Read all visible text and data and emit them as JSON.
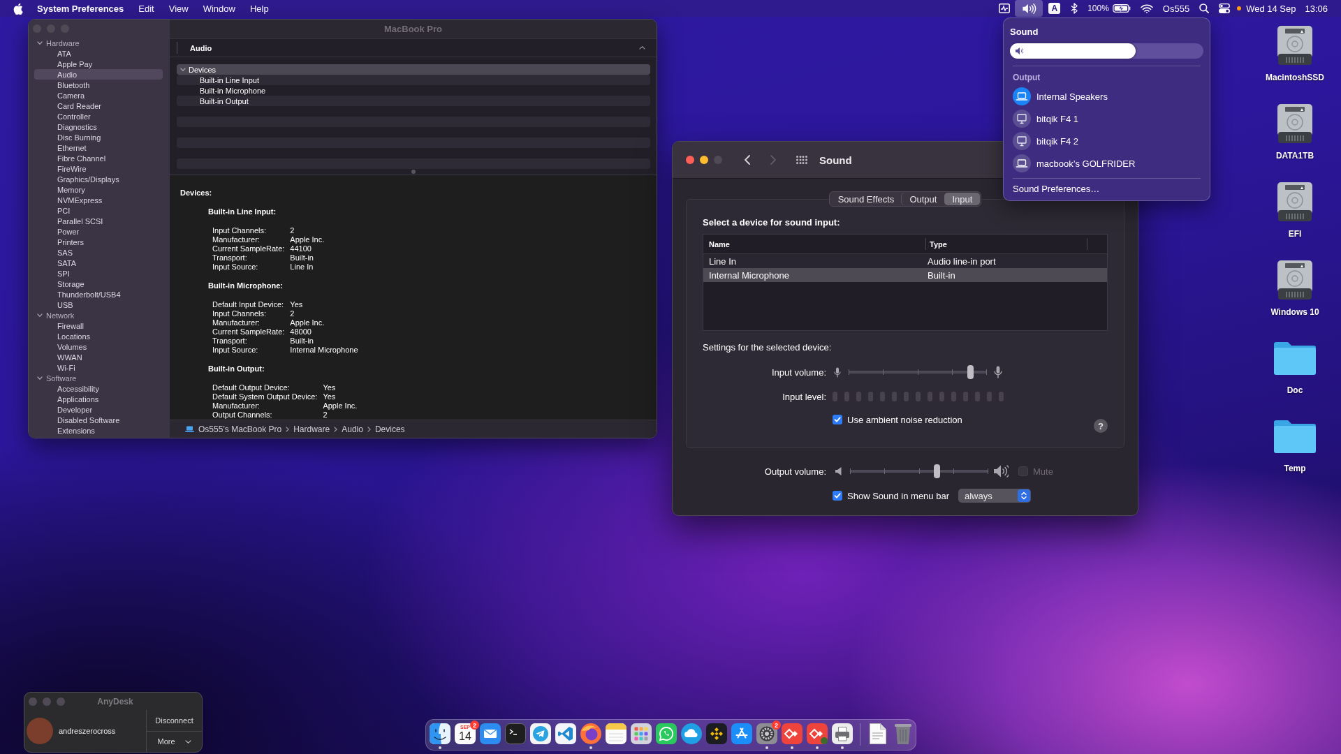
{
  "menu_bar": {
    "app_name": "System Preferences",
    "menus": [
      "Edit",
      "View",
      "Window",
      "Help"
    ],
    "status_items": [
      {
        "kind": "activity",
        "selected": false
      },
      {
        "kind": "volume",
        "selected": true
      },
      {
        "kind": "input_source",
        "label": "A",
        "selected": false
      },
      {
        "kind": "bluetooth",
        "selected": false
      },
      {
        "kind": "battery",
        "label": "100%",
        "selected": false
      },
      {
        "kind": "wifi",
        "selected": false
      },
      {
        "kind": "user",
        "label": "Os555",
        "selected": false
      },
      {
        "kind": "search",
        "selected": false
      },
      {
        "kind": "control_center",
        "selected": false
      },
      {
        "kind": "privacy_dot",
        "selected": false
      }
    ],
    "clock": {
      "date": "Wed 14 Sep",
      "time": "13:06"
    }
  },
  "system_information": {
    "title": "MacBook Pro",
    "focused": false,
    "sidebar": [
      {
        "label": "Hardware",
        "expanded": true,
        "children": [
          {
            "label": "ATA",
            "selected": false
          },
          {
            "label": "Apple Pay",
            "selected": false
          },
          {
            "label": "Audio",
            "selected": true
          },
          {
            "label": "Bluetooth",
            "selected": false
          },
          {
            "label": "Camera",
            "selected": false
          },
          {
            "label": "Card Reader",
            "selected": false
          },
          {
            "label": "Controller",
            "selected": false
          },
          {
            "label": "Diagnostics",
            "selected": false
          },
          {
            "label": "Disc Burning",
            "selected": false
          },
          {
            "label": "Ethernet",
            "selected": false
          },
          {
            "label": "Fibre Channel",
            "selected": false
          },
          {
            "label": "FireWire",
            "selected": false
          },
          {
            "label": "Graphics/Displays",
            "selected": false
          },
          {
            "label": "Memory",
            "selected": false
          },
          {
            "label": "NVMExpress",
            "selected": false
          },
          {
            "label": "PCI",
            "selected": false
          },
          {
            "label": "Parallel SCSI",
            "selected": false
          },
          {
            "label": "Power",
            "selected": false
          },
          {
            "label": "Printers",
            "selected": false
          },
          {
            "label": "SAS",
            "selected": false
          },
          {
            "label": "SATA",
            "selected": false
          },
          {
            "label": "SPI",
            "selected": false
          },
          {
            "label": "Storage",
            "selected": false
          },
          {
            "label": "Thunderbolt/USB4",
            "selected": false
          },
          {
            "label": "USB",
            "selected": false
          }
        ]
      },
      {
        "label": "Network",
        "expanded": true,
        "children": [
          {
            "label": "Firewall",
            "selected": false
          },
          {
            "label": "Locations",
            "selected": false
          },
          {
            "label": "Volumes",
            "selected": false
          },
          {
            "label": "WWAN",
            "selected": false
          },
          {
            "label": "Wi-Fi",
            "selected": false
          }
        ]
      },
      {
        "label": "Software",
        "expanded": true,
        "children": [
          {
            "label": "Accessibility",
            "selected": false
          },
          {
            "label": "Applications",
            "selected": false
          },
          {
            "label": "Developer",
            "selected": false
          },
          {
            "label": "Disabled Software",
            "selected": false
          },
          {
            "label": "Extensions",
            "selected": false
          }
        ]
      }
    ],
    "section": {
      "title": "Audio",
      "expanded": true
    },
    "tree": [
      {
        "label": "Devices",
        "expanded": true,
        "selected": true,
        "children": [
          {
            "label": "Built-in Line Input",
            "selected": false
          },
          {
            "label": "Built-in Microphone",
            "selected": false
          },
          {
            "label": "Built-in Output",
            "selected": false
          }
        ]
      }
    ],
    "details": {
      "heading": "Devices:",
      "devices": [
        {
          "name": "Built-in Line Input:",
          "properties": [
            {
              "key": "Input Channels:",
              "value": "2"
            },
            {
              "key": "Manufacturer:",
              "value": "Apple Inc."
            },
            {
              "key": "Current SampleRate:",
              "value": "44100"
            },
            {
              "key": "Transport:",
              "value": "Built-in"
            },
            {
              "key": "Input Source:",
              "value": "Line In"
            }
          ]
        },
        {
          "name": "Built-in Microphone:",
          "properties": [
            {
              "key": "Default Input Device:",
              "value": "Yes"
            },
            {
              "key": "Input Channels:",
              "value": "2"
            },
            {
              "key": "Manufacturer:",
              "value": "Apple Inc."
            },
            {
              "key": "Current SampleRate:",
              "value": "48000"
            },
            {
              "key": "Transport:",
              "value": "Built-in"
            },
            {
              "key": "Input Source:",
              "value": "Internal Microphone"
            }
          ]
        },
        {
          "name": "Built-in Output:",
          "properties": [
            {
              "key": "Default Output Device:",
              "value": "Yes"
            },
            {
              "key": "Default System Output Device:",
              "value": "Yes"
            },
            {
              "key": "Manufacturer:",
              "value": "Apple Inc."
            },
            {
              "key": "Output Channels:",
              "value": "2"
            }
          ]
        }
      ]
    },
    "path": [
      "Os555’s MacBook Pro",
      "Hardware",
      "Audio",
      "Devices"
    ]
  },
  "sound_window": {
    "title": "Sound",
    "focused": true,
    "zoom_enabled": false,
    "back_enabled": true,
    "forward_enabled": false,
    "tabs": [
      {
        "label": "Sound Effects",
        "selected": false
      },
      {
        "label": "Output",
        "selected": false
      },
      {
        "label": "Input",
        "selected": true
      }
    ],
    "prompt": "Select a device for sound input:",
    "table": {
      "columns": [
        "Name",
        "Type"
      ],
      "rows": [
        {
          "cells": [
            "Line In",
            "Audio line-in port"
          ],
          "selected": false
        },
        {
          "cells": [
            "Internal Microphone",
            "Built-in"
          ],
          "selected": true
        }
      ]
    },
    "settings_heading": "Settings for the selected device:",
    "input_volume": {
      "label": "Input volume:",
      "level": 0.88
    },
    "input_level": {
      "label": "Input level:",
      "level": 0
    },
    "noise_reduction": {
      "label": "Use ambient noise reduction",
      "checked": true
    },
    "help_label": "?",
    "output_volume": {
      "label": "Output volume:",
      "level": 0.63
    },
    "mute": {
      "label": "Mute",
      "checked": false,
      "disabled": true
    },
    "show_in_menu_bar": {
      "label": "Show Sound in menu bar",
      "checked": true
    },
    "menu_bar_visibility": {
      "value": "always"
    }
  },
  "sound_menu": {
    "title": "Sound",
    "volume": {
      "level": 0.65
    },
    "output_heading": "Output",
    "devices": [
      {
        "label": "Internal Speakers",
        "kind": "laptop",
        "selected": true
      },
      {
        "label": "bitqik F4 1",
        "kind": "display",
        "selected": false
      },
      {
        "label": "bitqik F4 2",
        "kind": "display",
        "selected": false
      },
      {
        "label": "macbook’s GOLFRIDER",
        "kind": "laptop",
        "selected": false
      }
    ],
    "preferences": "Sound Preferences…"
  },
  "desktop_icons": [
    {
      "label": "MacintoshSSD",
      "kind": "drive"
    },
    {
      "label": "DATA1TB",
      "kind": "drive"
    },
    {
      "label": "EFI",
      "kind": "drive"
    },
    {
      "label": "Windows 10",
      "kind": "drive"
    },
    {
      "label": "Doc",
      "kind": "folder"
    },
    {
      "label": "Temp",
      "kind": "folder"
    }
  ],
  "anydesk": {
    "title": "AnyDesk",
    "focused": false,
    "user": "andreszerocross",
    "buttons": [
      "Disconnect",
      "More"
    ]
  },
  "dock": {
    "apps": [
      {
        "kind": "finder",
        "running": true
      },
      {
        "kind": "calendar",
        "month": "SEP",
        "day": "14",
        "badge": "2",
        "running": false
      },
      {
        "kind": "mail",
        "running": false
      },
      {
        "kind": "terminal",
        "running": false
      },
      {
        "kind": "telegram",
        "running": false
      },
      {
        "kind": "code_editor",
        "running": false
      },
      {
        "kind": "browser",
        "running": true
      },
      {
        "kind": "notes",
        "running": false
      },
      {
        "kind": "launchpad",
        "running": false
      },
      {
        "kind": "messenger",
        "running": false
      },
      {
        "kind": "video_call",
        "running": false
      },
      {
        "kind": "exchange",
        "running": false
      },
      {
        "kind": "app_store",
        "running": false
      },
      {
        "kind": "settings",
        "badge": "2",
        "running": true
      },
      {
        "kind": "remote_desktop",
        "running": true
      },
      {
        "kind": "remote_desktop_photo",
        "running": true
      },
      {
        "kind": "printer",
        "running": true
      }
    ],
    "others": [
      {
        "kind": "document",
        "running": false
      },
      {
        "kind": "trash",
        "running": false
      }
    ]
  }
}
